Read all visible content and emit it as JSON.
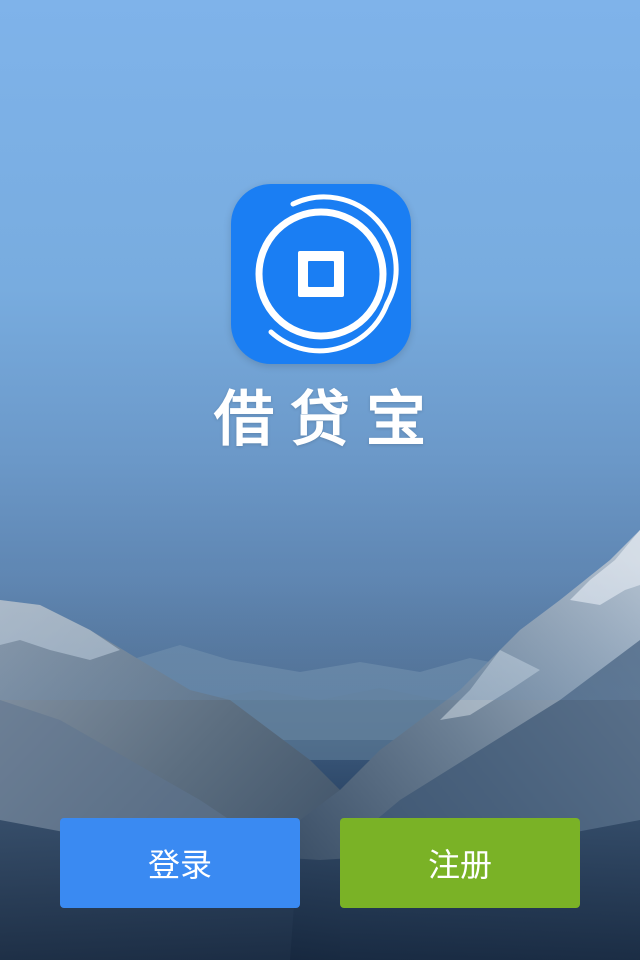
{
  "app": {
    "name": "借贷宝",
    "icon": "coin-logo-icon"
  },
  "background": {
    "description_icon": "mountain-landscape"
  },
  "buttons": {
    "login_label": "登录",
    "register_label": "注册"
  },
  "colors": {
    "icon_bg": "#1a7ef3",
    "login_button": "#3a8af2",
    "register_button": "#7ab226",
    "text": "#ffffff"
  }
}
